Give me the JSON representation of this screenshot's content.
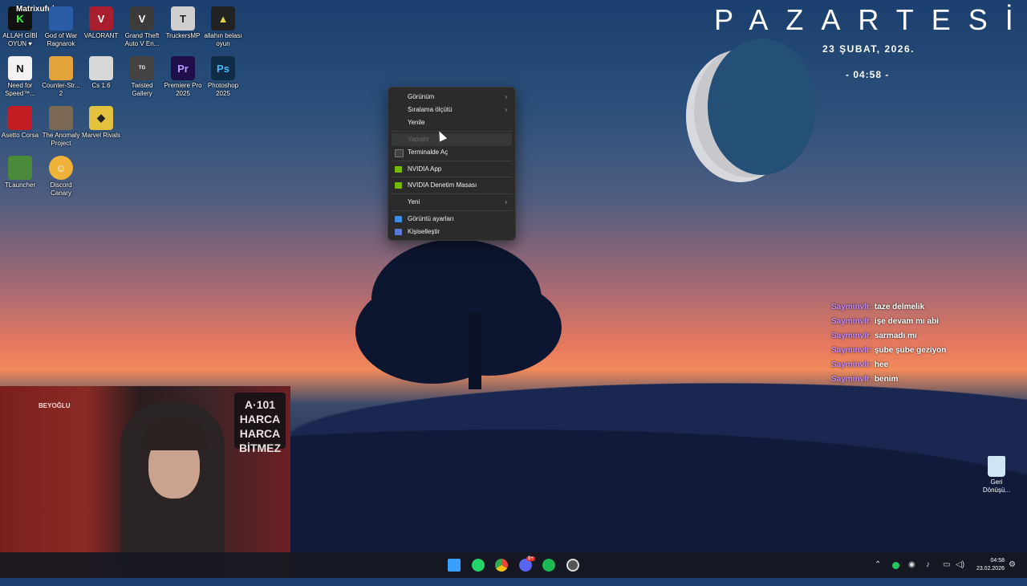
{
  "desktop": {
    "icons": [
      {
        "label": "ALLAH GİBİ OYUN ♥",
        "icon": "matrixufuk-icon",
        "color": "#1a1a1a"
      },
      {
        "label": "God of War Ragnarok",
        "icon": "god-of-war-icon",
        "color": "#2a5ca8"
      },
      {
        "label": "VALORANT",
        "icon": "valorant-icon",
        "color": "#a81e2e"
      },
      {
        "label": "Grand Theft Auto V En...",
        "icon": "gta-icon",
        "color": "#3b3b3b"
      },
      {
        "label": "TruckersMP",
        "icon": "truckersmp-icon",
        "color": "#cfcfcf"
      },
      {
        "label": "allahın belası oyun",
        "icon": "game-icon",
        "color": "#222"
      },
      {
        "label": "Need for Speed™...",
        "icon": "nfs-icon",
        "color": "#f2f2f2"
      },
      {
        "label": "Counter-Str... 2",
        "icon": "cs2-icon",
        "color": "#e3a23a"
      },
      {
        "label": "Cs 1.6",
        "icon": "cs16-icon",
        "color": "#d8d8d8"
      },
      {
        "label": "Twisted Gallery",
        "icon": "twisted-gallery-icon",
        "color": "#444"
      },
      {
        "label": "Premiere Pro 2025",
        "icon": "premiere-icon",
        "color": "#1e0f4a"
      },
      {
        "label": "Photoshop 2025",
        "icon": "photoshop-icon",
        "color": "#0f2b45"
      },
      {
        "label": "Asetto Corsa",
        "icon": "assetto-corsa-icon",
        "color": "#c21d22"
      },
      {
        "label": "The Anomaly Project",
        "icon": "anomaly-icon",
        "color": "#7a6a55"
      },
      {
        "label": "Marvel Rivals",
        "icon": "marvel-rivals-icon",
        "color": "#e2c23e"
      },
      {
        "label": "TLauncher",
        "icon": "tlauncher-icon",
        "color": "#4a8a3a"
      },
      {
        "label": "Discord Canary",
        "icon": "discord-canary-icon",
        "color": "#f0b33a"
      }
    ],
    "matrix_badge": "Matrixufuk",
    "recycle_bin": "Geri Dönüşü..."
  },
  "widget": {
    "day": "PAZARTESİ",
    "date": "23 ŞUBAT, 2026.",
    "time": "- 04:58 -"
  },
  "context_menu": {
    "items": [
      {
        "label": "Görünüm",
        "submenu": true,
        "state": "normal"
      },
      {
        "label": "Sıralama ölçütü",
        "submenu": true,
        "state": "normal"
      },
      {
        "label": "Yenile",
        "submenu": false,
        "state": "normal"
      },
      {
        "label": "Yapıştır",
        "submenu": false,
        "state": "disabled"
      },
      {
        "label": "Terminalde Aç",
        "submenu": false,
        "state": "normal",
        "icon": "terminal-icon"
      },
      {
        "label": "NVIDIA App",
        "submenu": false,
        "state": "normal",
        "icon": "nvidia-icon"
      },
      {
        "label": "NVIDIA Denetim Masası",
        "submenu": false,
        "state": "normal",
        "icon": "nvidia-icon"
      },
      {
        "label": "Yeni",
        "submenu": true,
        "state": "normal"
      },
      {
        "label": "Görüntü ayarları",
        "submenu": false,
        "state": "normal",
        "icon": "display-icon"
      },
      {
        "label": "Kişiselleştir",
        "submenu": false,
        "state": "normal",
        "icon": "personalize-icon"
      }
    ]
  },
  "chat": [
    {
      "user": "Sayminvlr:",
      "msg": "taze delmelik"
    },
    {
      "user": "Sayminvlr:",
      "msg": "işe devam mı abi"
    },
    {
      "user": "Sayminvlr:",
      "msg": "sarmadı mı"
    },
    {
      "user": "Sayminvlr:",
      "msg": "şube şube geziyon"
    },
    {
      "user": "Sayminvlr:",
      "msg": "hee"
    },
    {
      "user": "Sayminvlr:",
      "msg": "benim"
    }
  ],
  "webcam": {
    "sign": "A·101 HARCA HARCA BİTMEZ",
    "neon": "BEYOĞLU"
  },
  "taskbar": {
    "apps": [
      "start-icon",
      "whatsapp-icon",
      "chrome-icon",
      "discord-icon",
      "spotify-icon",
      "discord-canary-icon"
    ],
    "discord_badge": "9+",
    "clock_time": "04:58",
    "clock_date": "23.02.2026",
    "colors": {
      "start": "#3aa0ff",
      "whatsapp": "#25d366",
      "chrome": "#e8453c",
      "discord": "#5865f2",
      "spotify": "#1db954",
      "canary": "#f5b73b"
    }
  }
}
